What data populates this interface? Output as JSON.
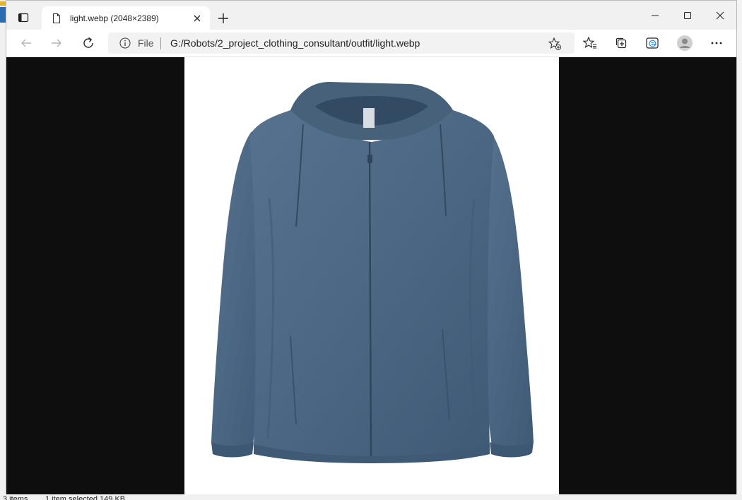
{
  "tab": {
    "title": "light.webp (2048×2389)"
  },
  "address_bar": {
    "scheme_label": "File",
    "url": "G:/Robots/2_project_clothing_consultant/outfit/light.webp"
  },
  "status_bar": {
    "items": "3 items",
    "selection": "1 item selected  149 KB"
  },
  "image": {
    "subject": "blue hooded windbreaker jacket",
    "jacket_color": "#4e6a86"
  }
}
